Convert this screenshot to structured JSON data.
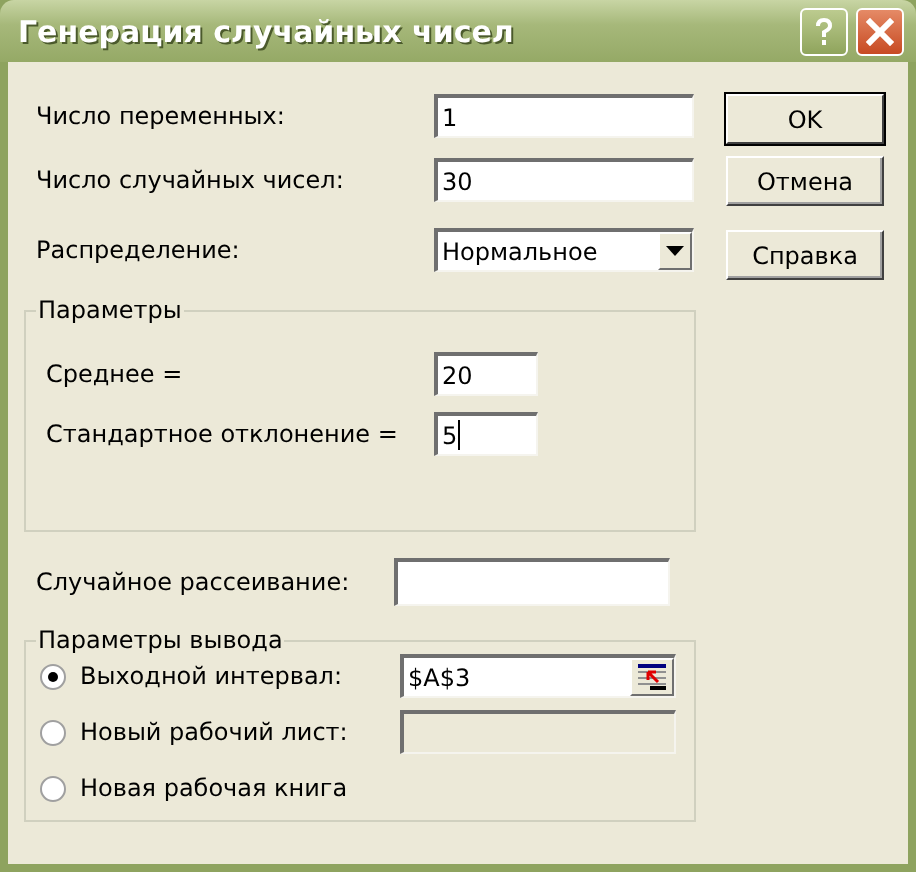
{
  "window": {
    "title": "Генерация случайных чисел"
  },
  "fields": [
    {
      "label": "Число переменных:",
      "value": "1"
    },
    {
      "label": "Число случайных чисел:",
      "value": "30"
    }
  ],
  "distribution": {
    "label": "Распределение:",
    "value": "Нормальное"
  },
  "buttons": [
    {
      "label": "OK",
      "default": true
    },
    {
      "label": "Отмена",
      "default": false
    },
    {
      "label": "Справка",
      "default": false
    }
  ],
  "parameters": {
    "title": "Параметры",
    "fields": [
      {
        "label": "Среднее =",
        "value": "20",
        "focused": false
      },
      {
        "label": "Стандартное отклонение =",
        "value": "5",
        "focused": true
      }
    ]
  },
  "random_seed": {
    "label": "Случайное рассеивание:"
  },
  "output": {
    "title": "Параметры вывода",
    "options": [
      {
        "label": "Выходной интервал:",
        "selected": true,
        "field": {
          "value": "$A$3",
          "disabled": false
        }
      },
      {
        "label": "Новый рабочий лист:",
        "selected": false,
        "field": {
          "disabled": true
        }
      },
      {
        "label": "Новая рабочая книга",
        "selected": false
      }
    ]
  }
}
